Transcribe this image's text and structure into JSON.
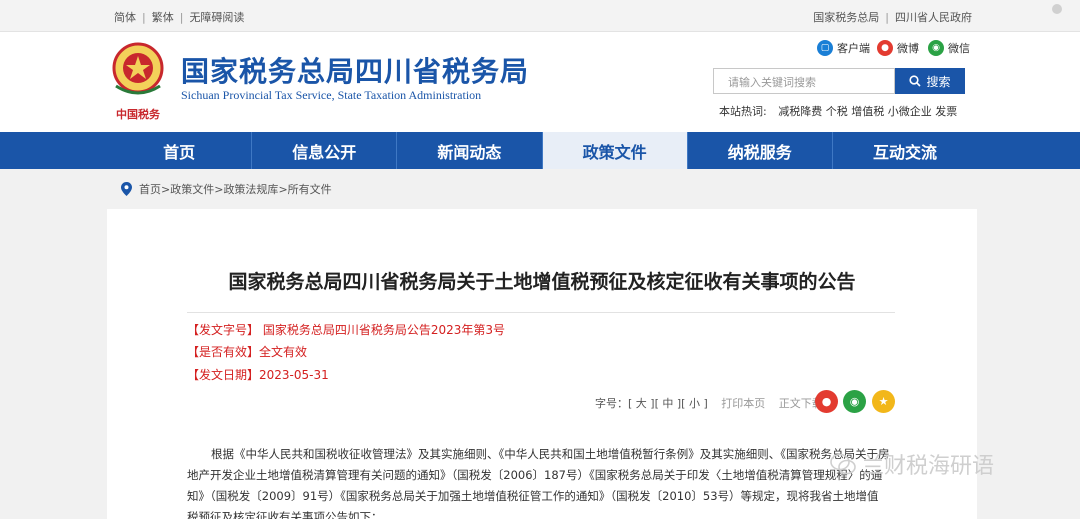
{
  "topbar": {
    "links_left": [
      "简体",
      "繁体",
      "无障碍阅读"
    ],
    "links_right": [
      "国家税务总局",
      "四川省人民政府"
    ]
  },
  "header": {
    "emblem_text": "中国税务",
    "title": "国家税务总局四川省税务局",
    "subtitle": "Sichuan Provincial Tax Service, State Taxation Administration",
    "social": [
      {
        "label": "客户端",
        "icon": "mobile-client-icon",
        "color": "#1a7fd6"
      },
      {
        "label": "微博",
        "icon": "weibo-icon",
        "color": "#e33b30"
      },
      {
        "label": "微信",
        "icon": "wechat-icon",
        "color": "#2ba245"
      }
    ],
    "search_placeholder": "请输入关键词搜索",
    "search_button": "搜索",
    "hotwords_label": "本站热词:",
    "hotwords": [
      "减税降费",
      "个税",
      "增值税",
      "小微企业",
      "发票"
    ]
  },
  "nav": {
    "items": [
      "首页",
      "信息公开",
      "新闻动态",
      "政策文件",
      "纳税服务",
      "互动交流"
    ],
    "active_index": 3
  },
  "breadcrumb": [
    "首页",
    "政策文件",
    "政策法规库",
    "所有文件"
  ],
  "article": {
    "title": "国家税务总局四川省税务局关于土地增值税预征及核定征收有关事项的公告",
    "doc_no_label": "【发文字号】",
    "doc_no": "国家税务总局四川省税务局公告2023年第3号",
    "valid_label": "【是否有效】",
    "valid": "全文有效",
    "date_label": "【发文日期】",
    "date": "2023-05-31",
    "font_size_label": "字号：",
    "font_large": "[ 大 ]",
    "font_medium": "[ 中 ]",
    "font_small": "[ 小 ]",
    "print": "打印本页",
    "download": "正文下载",
    "body_line1": "根据《中华人民共和国税收征收管理法》及其实施细则、《中华人民共和国土地增值税暂行条例》及其实施细则、《国家税务总局关于房",
    "body_line2": "地产开发企业土地增值税清算管理有关问题的通知》（国税发〔2006〕187号）《国家税务总局关于印发〈土地增值税清算管理规程〉的通",
    "body_line3": "知》（国税发〔2009〕91号）《国家税务总局关于加强土地增值税征管工作的通知》（国税发〔2010〕53号）等规定，现将我省土地增值",
    "body_line4": "税预征及核定征收有关事项公告如下："
  },
  "watermark": "兰财税海研语",
  "colors": {
    "brand": "#1a55a8",
    "meta_red": "#d42020"
  }
}
